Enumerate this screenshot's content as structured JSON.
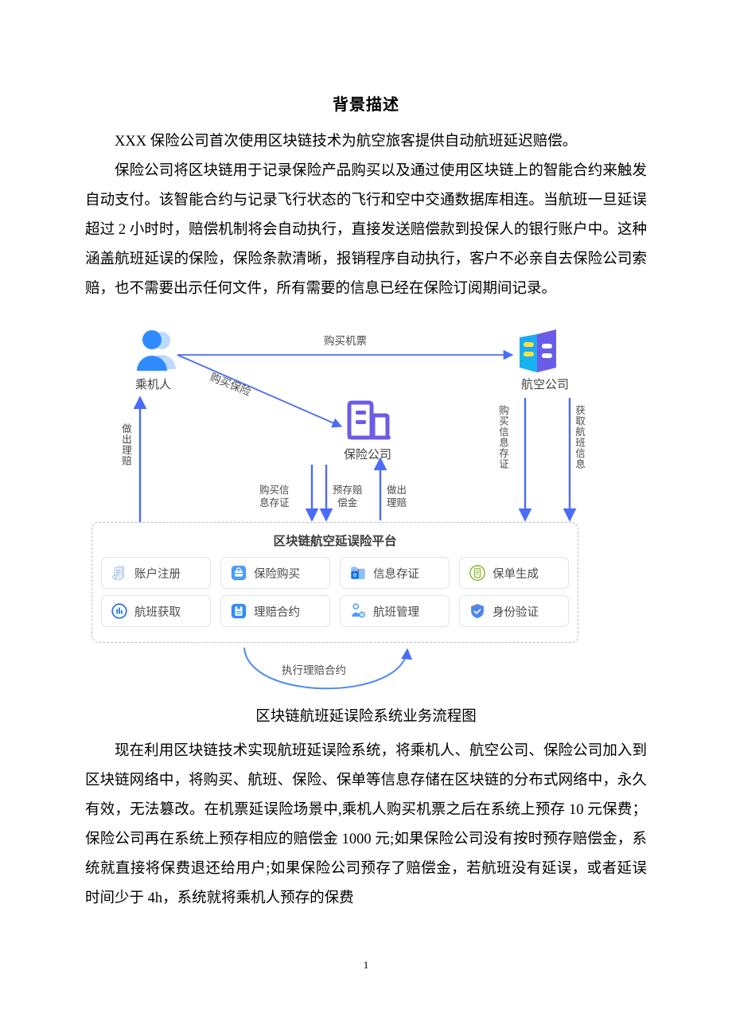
{
  "document": {
    "title": "背景描述",
    "paragraphs": [
      "XXX 保险公司首次使用区块链技术为航空旅客提供自动航班延迟赔偿。",
      "保险公司将区块链用于记录保险产品购买以及通过使用区块链上的智能合约来触发自动支付。该智能合约与记录飞行状态的飞行和空中交通数据库相连。当航班一旦延误超过 2 小时时，赔偿机制将会自动执行，直接发送赔偿款到投保人的银行账户中。这种涵盖航班延误的保险，保险条款清晰，报销程序自动执行，客户不必亲自去保险公司索赔，也不需要出示任何文件，所有需要的信息已经在保险订阅期间记录。",
      "现在利用区块链技术实现航班延误险系统，将乘机人、航空公司、保险公司加入到区块链网络中，将购买、航班、保险、保单等信息存储在区块链的分布式网络中，永久有效，无法篡改。在机票延误险场景中,乘机人购买机票之后在系统上预存 10 元保费；保险公司再在系统上预存相应的赔偿金 1000 元;如果保险公司没有按时预存赔偿金，系统就直接将保费退还给用户;如果保险公司预存了赔偿金，若航班没有延误，或者延误时间少于 4h，系统就将乘机人预存的保费"
    ],
    "page_number": "1"
  },
  "figure": {
    "caption": "区块链航班延误险系统业务流程图",
    "nodes": {
      "passenger": "乘机人",
      "insurer": "保险公司",
      "airline": "航空公司"
    },
    "edges": {
      "buy_ticket": "购买机票",
      "buy_insurance": "购买保险",
      "make_claim_left": "做出理赔",
      "buy_info_cert_mid": "购买信\n息存证",
      "prepay_compensation": "预存赔\n偿金",
      "make_claim_mid": "做出\n理赔",
      "buy_info_cert_right": "购买信息存证",
      "get_flight_info": "获取航班信息",
      "execute_claim_contract": "执行理赔合约"
    },
    "platform": {
      "title": "区块链航空延误险平台",
      "tiles": [
        {
          "label": "账户注册",
          "icon": "document-stack-icon"
        },
        {
          "label": "保险购买",
          "icon": "briefcase-icon"
        },
        {
          "label": "信息存证",
          "icon": "folder-e-icon"
        },
        {
          "label": "保单生成",
          "icon": "policy-circle-icon"
        },
        {
          "label": "航班获取",
          "icon": "chart-circle-icon"
        },
        {
          "label": "理赔合约",
          "icon": "contract-doc-icon"
        },
        {
          "label": "航班管理",
          "icon": "user-gear-icon"
        },
        {
          "label": "身份验证",
          "icon": "shield-check-icon"
        }
      ]
    },
    "colors": {
      "arrow": "#4a6cf7",
      "accent_blue": "#2f8bff",
      "accent_purple": "#6b5ce7",
      "panel_border": "#b9bcc4",
      "tile_border": "#dfe3ea"
    }
  }
}
